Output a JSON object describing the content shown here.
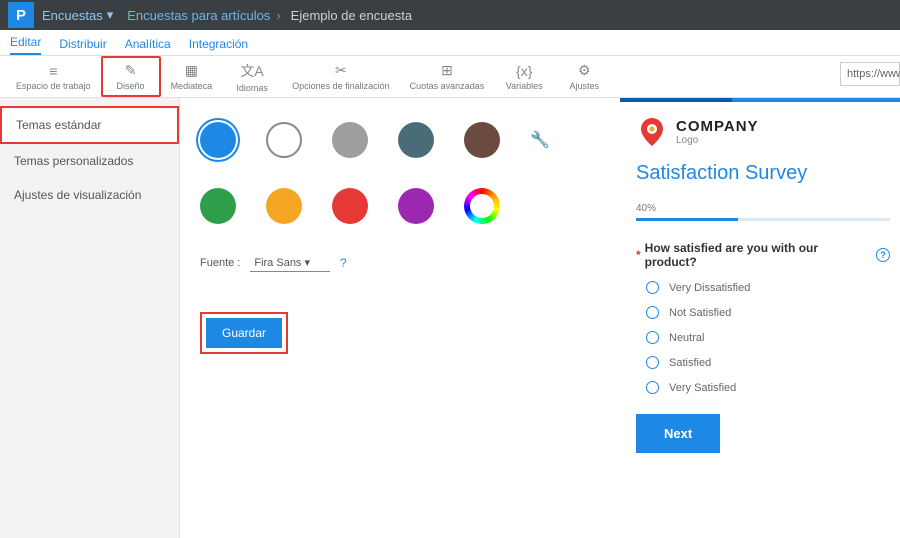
{
  "topbar": {
    "logo_letter": "P",
    "dropdown": "Encuestas",
    "crumb1": "Encuestas para artículos",
    "crumb2": "Ejemplo de encuesta"
  },
  "tabs": [
    "Editar",
    "Distribuir",
    "Analítica",
    "Integración"
  ],
  "toolbar": [
    {
      "label": "Espacio de trabajo",
      "icon": "≡"
    },
    {
      "label": "Diseño",
      "icon": "✎"
    },
    {
      "label": "Mediateca",
      "icon": "▦"
    },
    {
      "label": "Idiomas",
      "icon": "文A"
    },
    {
      "label": "Opciones de finalización",
      "icon": "✂"
    },
    {
      "label": "Cuotas avanzadas",
      "icon": "⊞"
    },
    {
      "label": "Variables",
      "icon": "{x}"
    },
    {
      "label": "Ajustes",
      "icon": "⚙"
    }
  ],
  "url_text": "https://www.c",
  "sidebar": {
    "items": [
      "Temas estándar",
      "Temas personalizados",
      "Ajustes de visualización"
    ]
  },
  "colors_row1": [
    "#1e88e5",
    "outline",
    "#9e9e9e",
    "#4a6b78",
    "#6b4a3f"
  ],
  "colors_row2": [
    "#2e9e4a",
    "#f5a623",
    "#e53935",
    "#9c27b0",
    "rainbow"
  ],
  "font_label": "Fuente :",
  "font_value": "Fira Sans",
  "save_label": "Guardar",
  "preview": {
    "company": "COMPANY",
    "logo_sub": "Logo",
    "title": "Satisfaction Survey",
    "progress": "40%",
    "question": "How satisfied are you with our product?",
    "options": [
      "Very Dissatisfied",
      "Not Satisfied",
      "Neutral",
      "Satisfied",
      "Very Satisfied"
    ],
    "next": "Next"
  }
}
